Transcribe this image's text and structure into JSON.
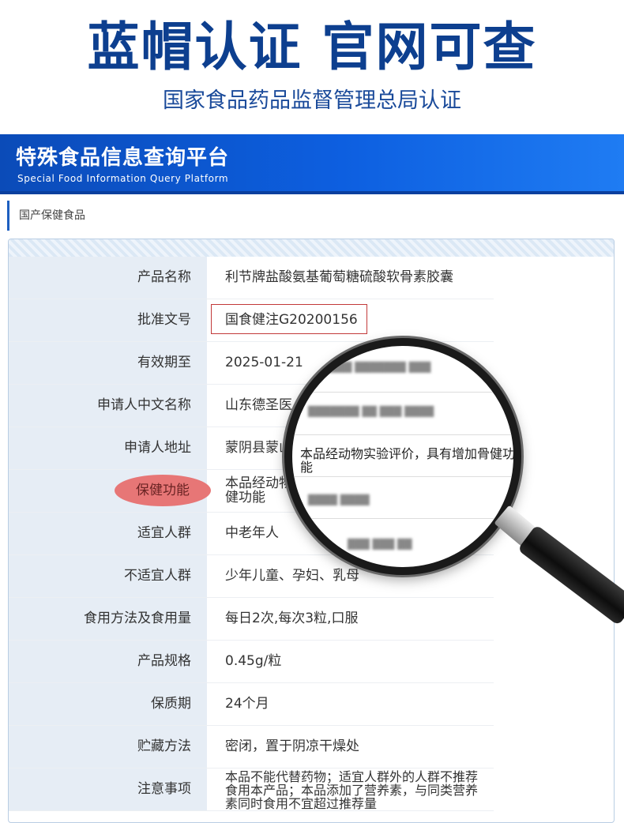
{
  "hero": {
    "title": "蓝帽认证 官网可查",
    "subtitle": "国家食品药品监督管理总局认证"
  },
  "banner": {
    "title": "特殊食品信息查询平台",
    "subtitle": "Special Food Information Query Platform"
  },
  "breadcrumb": "国产保健食品",
  "table": {
    "rows": [
      {
        "label": "产品名称",
        "value": "利节牌盐酸氨基葡萄糖硫酸软骨素胶囊"
      },
      {
        "label": "批准文号",
        "value": "国食健注G20200156"
      },
      {
        "label": "有效期至",
        "value": "2025-01-21"
      },
      {
        "label": "申请人中文名称",
        "value": "山东德圣医"
      },
      {
        "label": "申请人地址",
        "value": "蒙阴县蒙山"
      },
      {
        "label": "保健功能",
        "value": "本品经动物\n健功能"
      },
      {
        "label": "适宜人群",
        "value": "中老年人"
      },
      {
        "label": "不适宜人群",
        "value": "少年儿童、孕妇、乳母"
      },
      {
        "label": "食用方法及食用量",
        "value": "每日2次,每次3粒,口服"
      },
      {
        "label": "产品规格",
        "value": "0.45g/粒"
      },
      {
        "label": "保质期",
        "value": "24个月"
      },
      {
        "label": "贮藏方法",
        "value": "密闭，置于阴凉干燥处"
      },
      {
        "label": "注意事项",
        "value": "本品不能代替药物；适宜人群外的人群不推荐食用本产品；本品添加了营养素，与同类营养素同时食用不宜超过推荐量"
      }
    ]
  },
  "magnifier": {
    "text": "本品经动物实验评价，具有增加骨健功能"
  },
  "colors": {
    "brand_blue": "#0d3f8f",
    "banner_blue": "#0d5fe0",
    "highlight_red": "#e77676",
    "box_red": "#c23a3a"
  }
}
